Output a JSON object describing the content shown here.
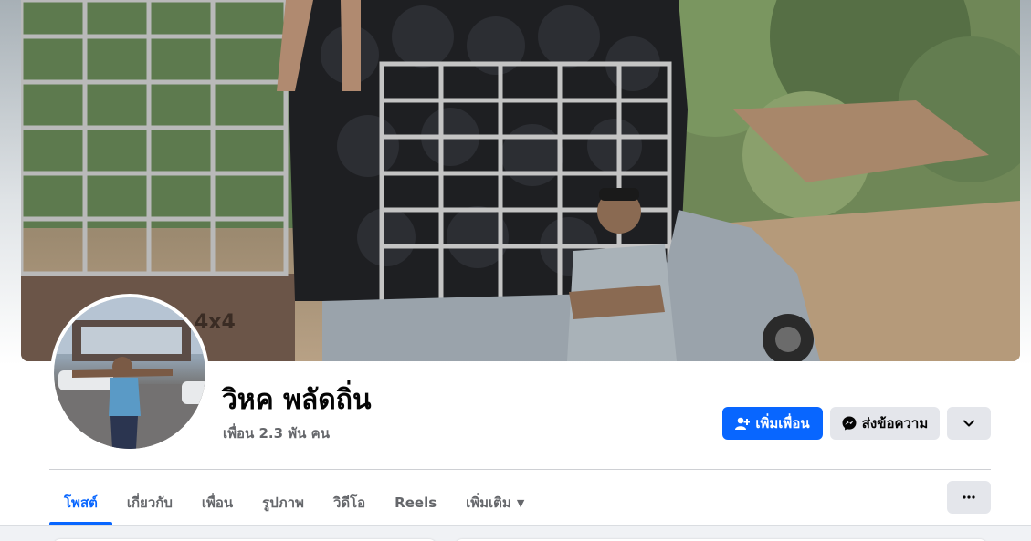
{
  "profile": {
    "name": "วิหค พลัดถิ่น",
    "friends_count": "เพื่อน 2.3 พัน คน"
  },
  "cover_photo": {
    "vehicle_badge": "4x4",
    "icon": "cover-photo"
  },
  "actions": {
    "add_friend_label": "เพิ่มเพื่อน",
    "add_friend_icon": "person-add-icon",
    "message_label": "ส่งข้อความ",
    "message_icon": "messenger-icon",
    "more_icon": "chevron-down-icon"
  },
  "tabs": [
    {
      "label": "โพสต์",
      "active": true
    },
    {
      "label": "เกี่ยวกับ",
      "active": false
    },
    {
      "label": "เพื่อน",
      "active": false
    },
    {
      "label": "รูปภาพ",
      "active": false
    },
    {
      "label": "วิดีโอ",
      "active": false
    },
    {
      "label": "Reels",
      "active": false
    },
    {
      "label": "เพิ่มเติม",
      "active": false,
      "dropdown": true
    }
  ],
  "tabs_more_icon": "ellipsis-icon",
  "colors": {
    "accent": "#0866ff",
    "secondary_button": "#e4e6eb",
    "muted_text": "#65676b",
    "feed_background": "#f0f2f5"
  }
}
